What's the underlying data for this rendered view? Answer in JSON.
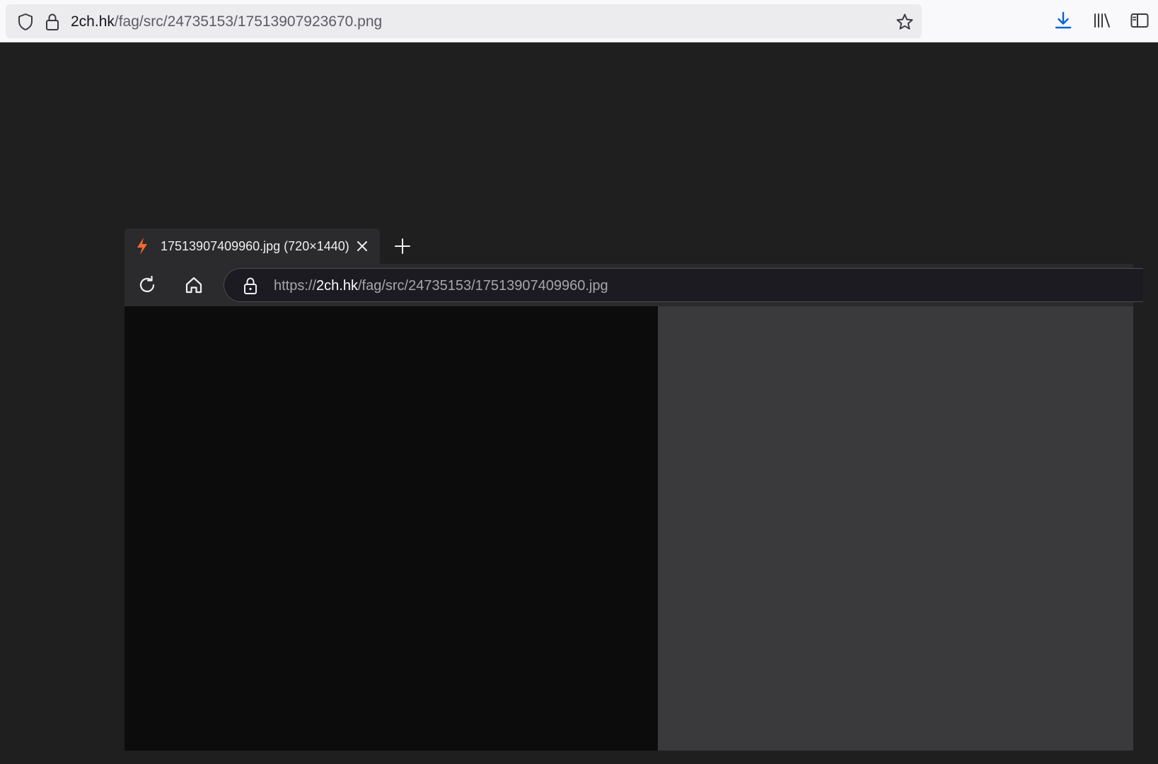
{
  "browser": {
    "url_host": "2ch.hk",
    "url_path": "/fag/src/24735153/17513907923670.png",
    "toolbar": {
      "download_icon": "download-icon",
      "library_icon": "library-icon",
      "sidebar_icon": "sidebar-icon"
    },
    "colors": {
      "download_accent": "#0061e0"
    }
  },
  "inner_screenshot": {
    "tab": {
      "title": "17513907409960.jpg (720×1440)",
      "favicon": "lightning-icon",
      "favicon_color": "#f56a32"
    },
    "url": {
      "scheme": "https://",
      "host": "2ch.hk",
      "path": "/fag/src/24735153/17513907409960.jpg"
    },
    "image": {
      "content": "photo omitted"
    }
  }
}
